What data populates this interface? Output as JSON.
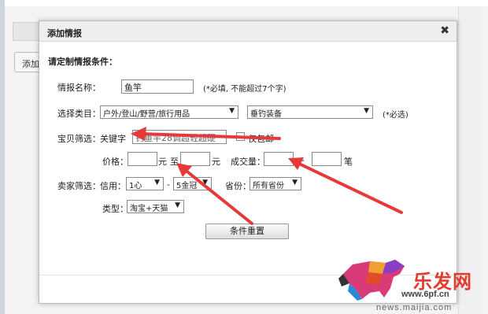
{
  "background": {
    "tab_label": "添加"
  },
  "dialog": {
    "title": "添加情报",
    "close_label": "✖",
    "section_heading": "请定制情报条件：",
    "name": {
      "label": "情报名称：",
      "value": "鱼竿",
      "hint": "(*必填, 不能超过7个字)"
    },
    "category": {
      "label": "选择类目：",
      "primary": "户外/登山/野营/旅行用品",
      "secondary": "垂钓装备",
      "hint": "(*必选)"
    },
    "filter": {
      "label": "宝贝筛选：",
      "keyword_label": "关键字",
      "keyword_value": "钓鱼竿28调超轻超硬",
      "free_shipping_label": "仅包邮"
    },
    "price": {
      "label": "价格：",
      "unit1": "元",
      "to": "至",
      "unit2": "元"
    },
    "volume": {
      "label": "成交量：",
      "dash": "-",
      "unit": "笔"
    },
    "seller": {
      "label": "卖家筛选：",
      "credit_label": "信用：",
      "credit_min": "1心",
      "dash": "-",
      "credit_max": "5金冠",
      "province_label": "省份：",
      "province": "所有省份"
    },
    "type": {
      "label": "类型：",
      "value": "淘宝+天猫"
    },
    "reset_button": "条件重置"
  },
  "watermark": {
    "brand": "乐发网",
    "url1": "www.6pf.cn",
    "url2": "news.maijia.com"
  },
  "colors": {
    "arrow": "#e5393a",
    "watermark_red": "#e23b2e"
  }
}
